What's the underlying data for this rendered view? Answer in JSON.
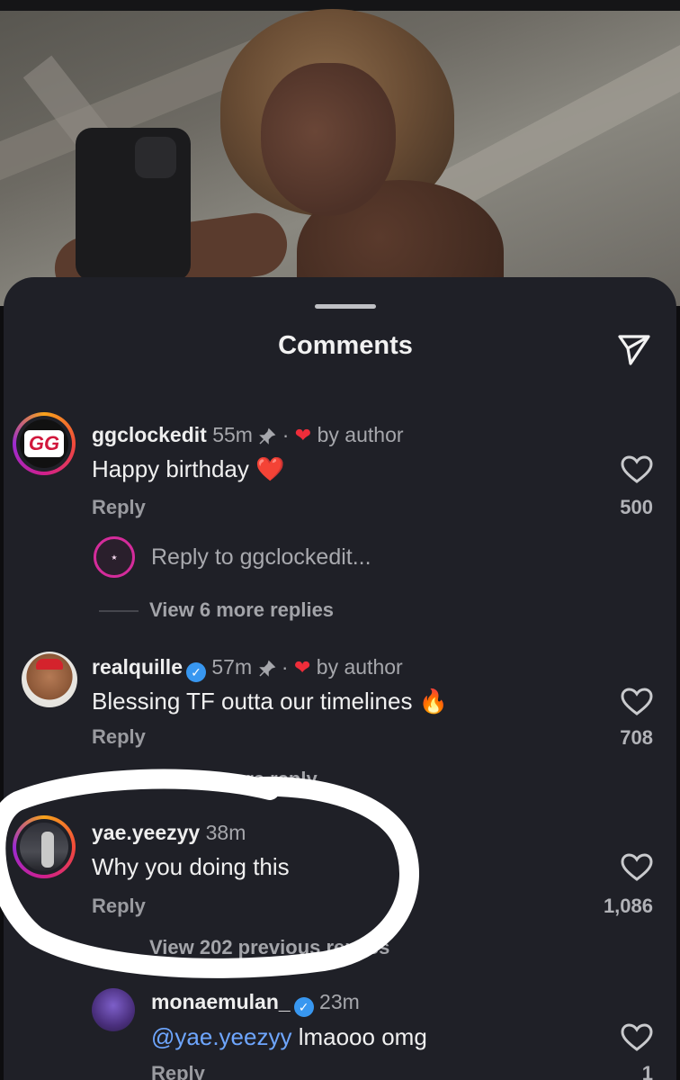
{
  "header": {
    "title": "Comments"
  },
  "comments": [
    {
      "username": "ggclockedit",
      "time": "55m",
      "separator": "·",
      "author_badge": "by author",
      "text": "Happy birthday",
      "text_emoji": "❤️",
      "reply_label": "Reply",
      "likes": "500",
      "reply_placeholder": "Reply to ggclockedit...",
      "view_more": "View 6 more replies",
      "avatar_text": "GG"
    },
    {
      "username": "realquille",
      "time": "57m",
      "separator": "·",
      "author_badge": "by author",
      "text": "Blessing TF outta our timelines",
      "text_emoji": "🔥",
      "reply_label": "Reply",
      "likes": "708",
      "view_more": "View 1 more reply"
    },
    {
      "username": "yae.yeezyy",
      "time": "38m",
      "text": "Why you doing this",
      "reply_label": "Reply",
      "likes": "1,086",
      "view_more": "View 202 previous replies"
    },
    {
      "username": "monaemulan_",
      "time": "23m",
      "mention": "@yae.yeezyy",
      "text": "lmaooo omg",
      "reply_label": "Reply",
      "likes": "1"
    }
  ],
  "colors": {
    "sheet_bg": "#1f2027",
    "heart_red": "#ee2d3a",
    "verified_blue": "#3897f0",
    "mention_blue": "#6ea6ff"
  },
  "icons": [
    "send-icon",
    "pin-icon",
    "heart-icon",
    "heart-outline-icon",
    "verified-icon"
  ]
}
